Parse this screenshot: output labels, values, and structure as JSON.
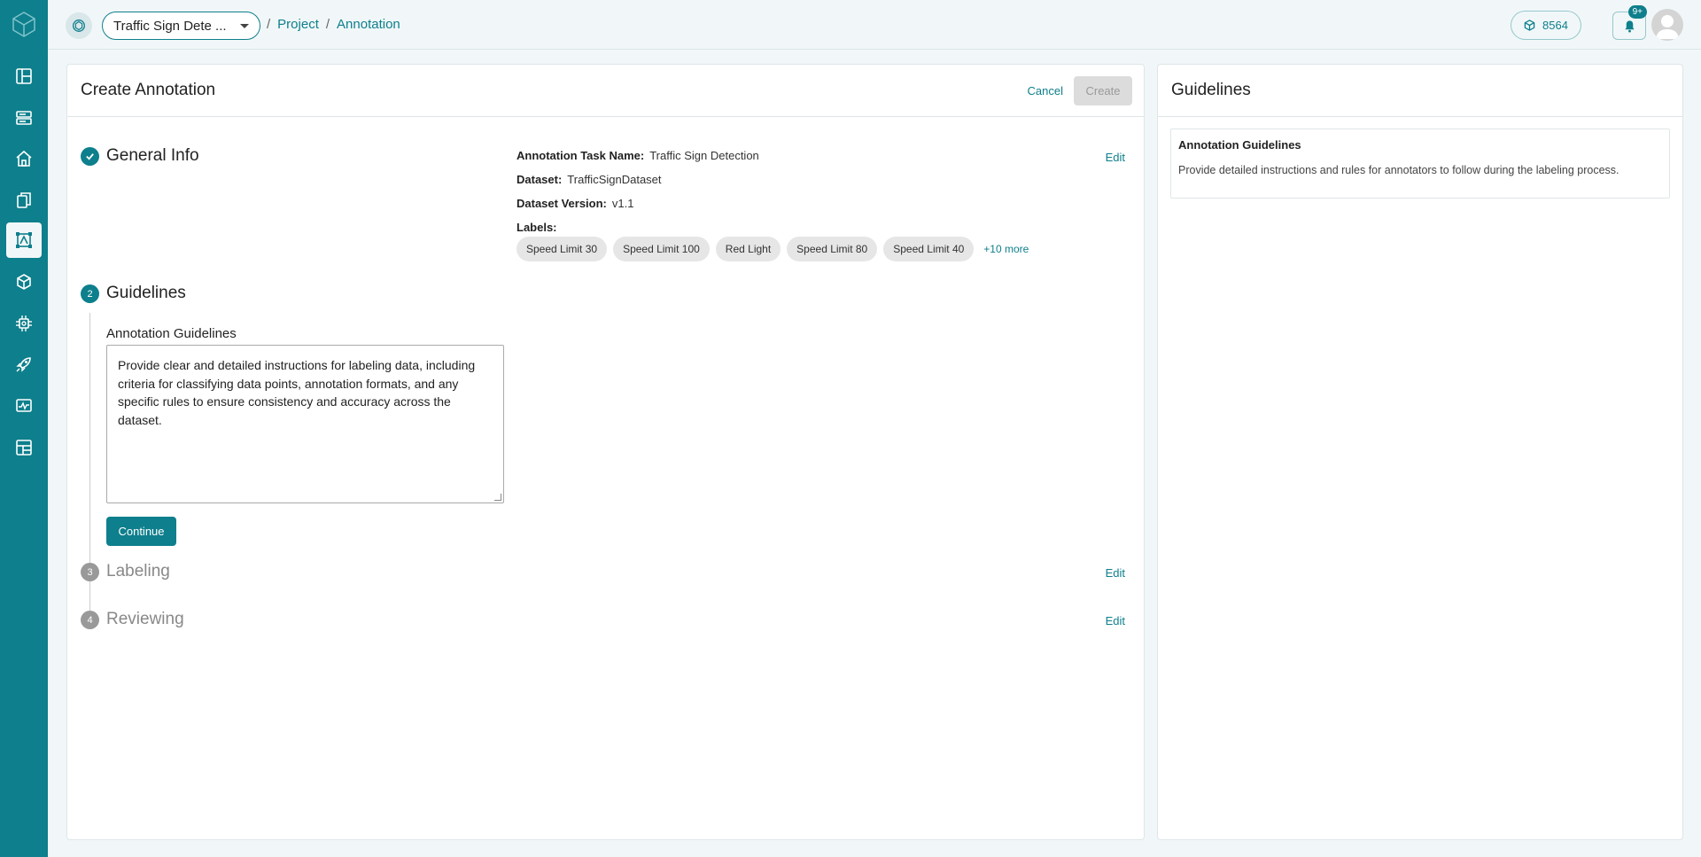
{
  "colors": {
    "accent": "#0e7f8c",
    "background": "#f1f7f8"
  },
  "sidebar": {
    "items": [
      {
        "icon": "layout-icon"
      },
      {
        "icon": "storage-icon"
      },
      {
        "icon": "home-icon"
      },
      {
        "icon": "documents-icon"
      },
      {
        "icon": "annotation-icon",
        "active": true
      },
      {
        "icon": "model-cube-icon"
      },
      {
        "icon": "chip-icon"
      },
      {
        "icon": "rocket-icon"
      },
      {
        "icon": "monitor-icon"
      },
      {
        "icon": "dashboard-icon"
      }
    ]
  },
  "header": {
    "project_select": "Traffic Sign Dete ...",
    "breadcrumb": {
      "sep": "/",
      "project": "Project",
      "annotation": "Annotation"
    },
    "credits": "8564",
    "notifications_badge": "9+"
  },
  "main": {
    "title": "Create Annotation",
    "cancel_label": "Cancel",
    "create_label": "Create",
    "steps": {
      "general": {
        "title": "General Info",
        "edit": "Edit",
        "task_name_label": "Annotation Task Name:",
        "task_name": "Traffic Sign Detection",
        "dataset_label": "Dataset:",
        "dataset": "TrafficSignDataset",
        "version_label": "Dataset Version:",
        "version": "v1.1",
        "labels_label": "Labels:",
        "labels": [
          "Speed Limit 30",
          "Speed Limit 100",
          "Red Light",
          "Speed Limit 80",
          "Speed Limit 40"
        ],
        "more": "+10 more"
      },
      "guidelines": {
        "number": "2",
        "title": "Guidelines",
        "field_label": "Annotation Guidelines",
        "value": "Provide clear and detailed instructions for labeling data, including criteria for classifying data points, annotation formats, and any specific rules to ensure consistency and accuracy across the dataset.",
        "continue_label": "Continue"
      },
      "labeling": {
        "number": "3",
        "title": "Labeling",
        "edit": "Edit"
      },
      "reviewing": {
        "number": "4",
        "title": "Reviewing",
        "edit": "Edit"
      }
    }
  },
  "side": {
    "title": "Guidelines",
    "card_title": "Annotation Guidelines",
    "card_text": "Provide detailed instructions and rules for annotators to follow during the labeling process."
  }
}
